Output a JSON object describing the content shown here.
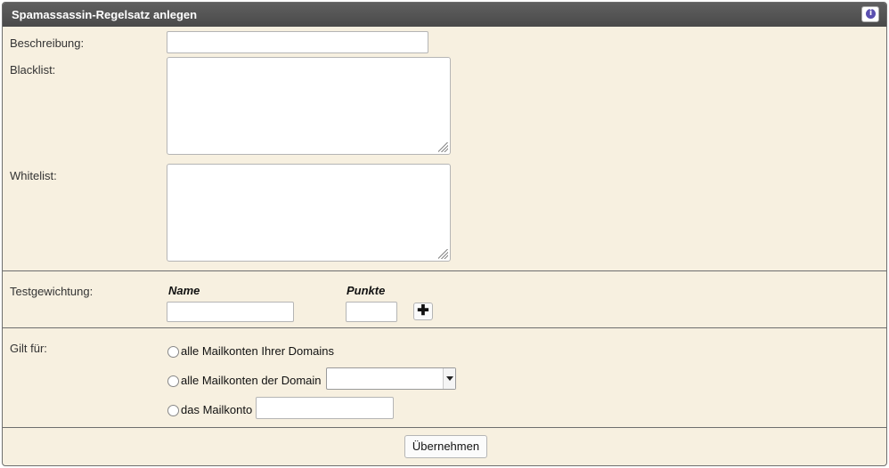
{
  "header": {
    "title": "Spamassassin-Regelsatz anlegen",
    "info_icon": "info-icon",
    "info_glyph": "i",
    "info_color": "#5a4fb0"
  },
  "form": {
    "beschreibung_label": "Beschreibung:",
    "beschreibung_value": "",
    "blacklist_label": "Blacklist:",
    "blacklist_value": "",
    "whitelist_label": "Whitelist:",
    "whitelist_value": ""
  },
  "testgewichtung": {
    "label": "Testgewichtung:",
    "col_name": "Name",
    "col_punkte": "Punkte",
    "name_value": "",
    "punkte_value": "",
    "add_glyph": "✚"
  },
  "gilt_fuer": {
    "label": "Gilt für:",
    "options": [
      {
        "label": "alle Mailkonten Ihrer Domains",
        "checked": false
      },
      {
        "label": "alle Mailkonten der Domain",
        "checked": false
      },
      {
        "label": "das Mailkonto",
        "checked": false
      }
    ],
    "domain_select_value": "",
    "mailkonto_value": ""
  },
  "footer": {
    "submit_label": "Übernehmen"
  },
  "colors": {
    "titlebar": "#4f4f4f",
    "panel_bg": "#f7f0e0",
    "border": "#6e6e6e"
  }
}
